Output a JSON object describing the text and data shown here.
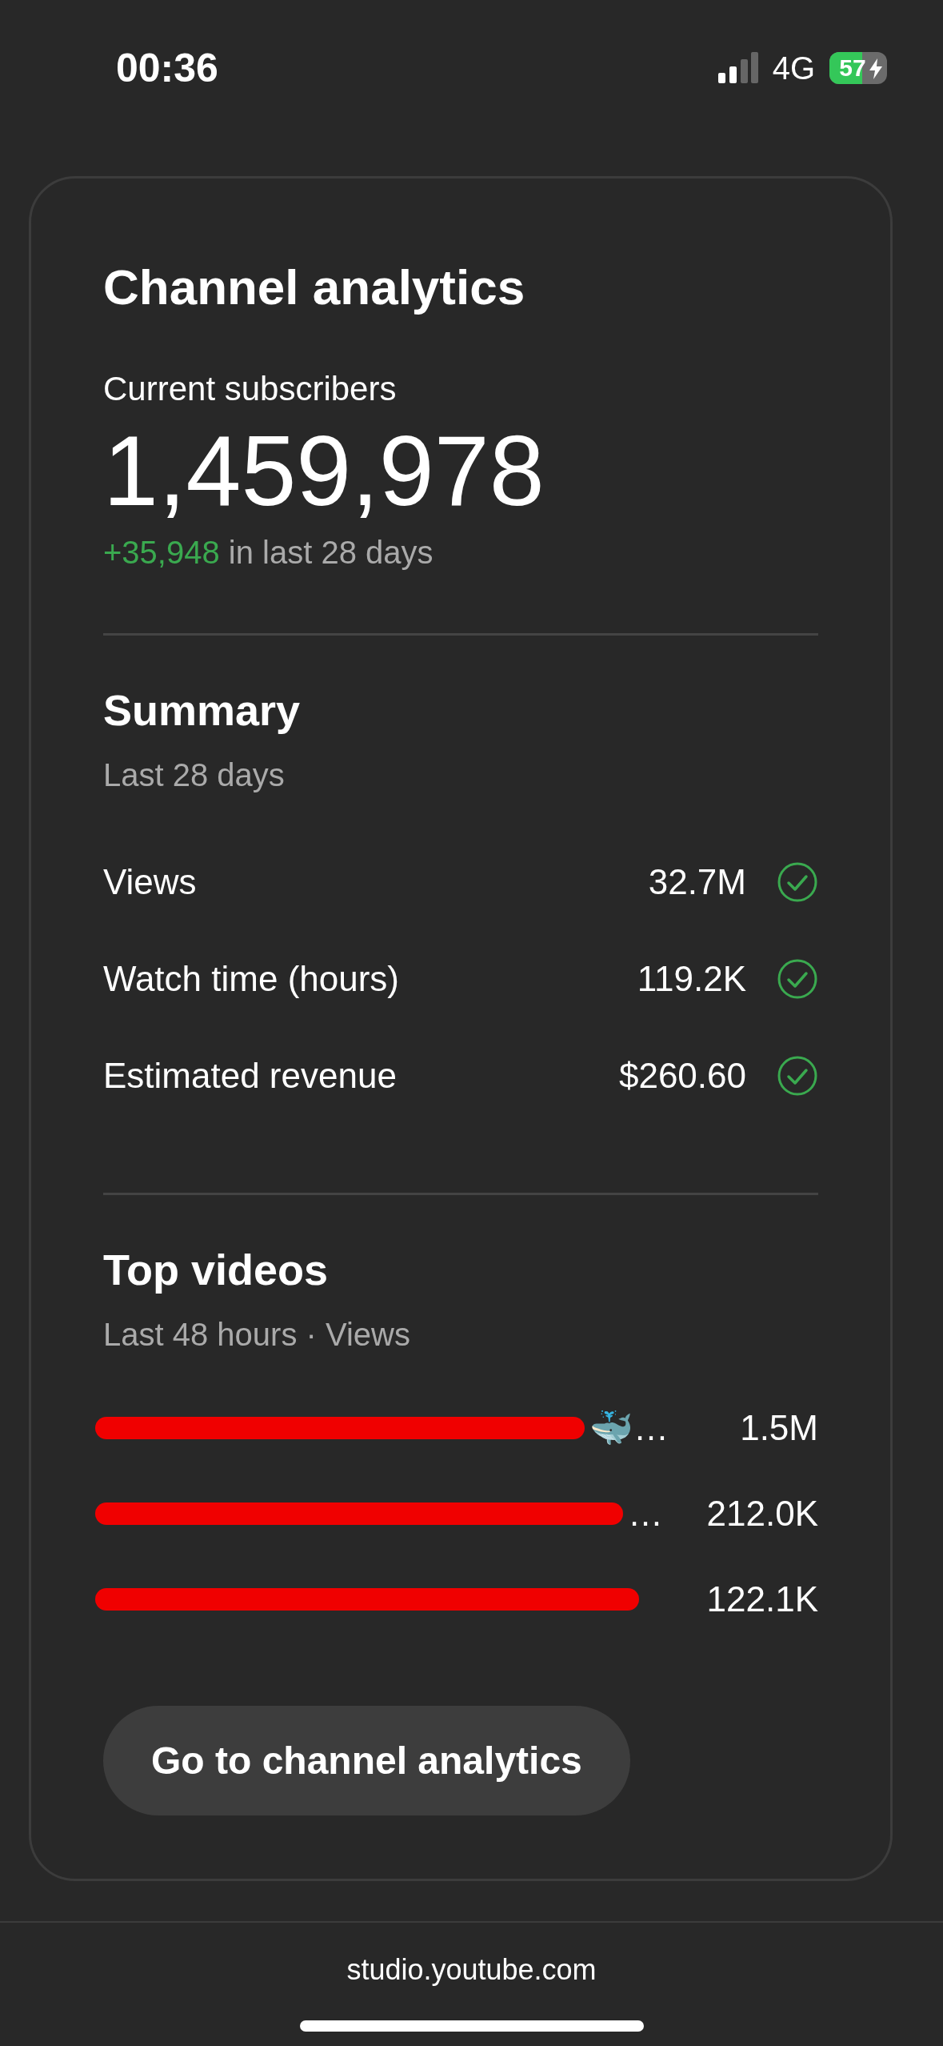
{
  "status_bar": {
    "time": "00:36",
    "network": "4G",
    "battery": "57",
    "charging": true
  },
  "card": {
    "title": "Channel analytics",
    "subscribers": {
      "label": "Current subscribers",
      "value": "1,459,978",
      "change": "+35,948",
      "change_suffix": "in last 28 days"
    },
    "summary": {
      "title": "Summary",
      "subtitle": "Last 28 days",
      "metrics": [
        {
          "label": "Views",
          "value": "32.7M",
          "checked": true
        },
        {
          "label": "Watch time (hours)",
          "value": "119.2K",
          "checked": true
        },
        {
          "label": "Estimated revenue",
          "value": "$260.60",
          "checked": true
        }
      ]
    },
    "top_videos": {
      "title": "Top videos",
      "subtitle": "Last 48 hours · Views",
      "videos": [
        {
          "title_tail": "🐳…",
          "views": "1.5M",
          "redacted": true
        },
        {
          "title_tail": "…",
          "views": "212.0K",
          "redacted": true
        },
        {
          "views": "122.1K",
          "redacted": true
        }
      ]
    },
    "button": "Go to channel analytics"
  },
  "browser": {
    "url": "studio.youtube.com"
  }
}
